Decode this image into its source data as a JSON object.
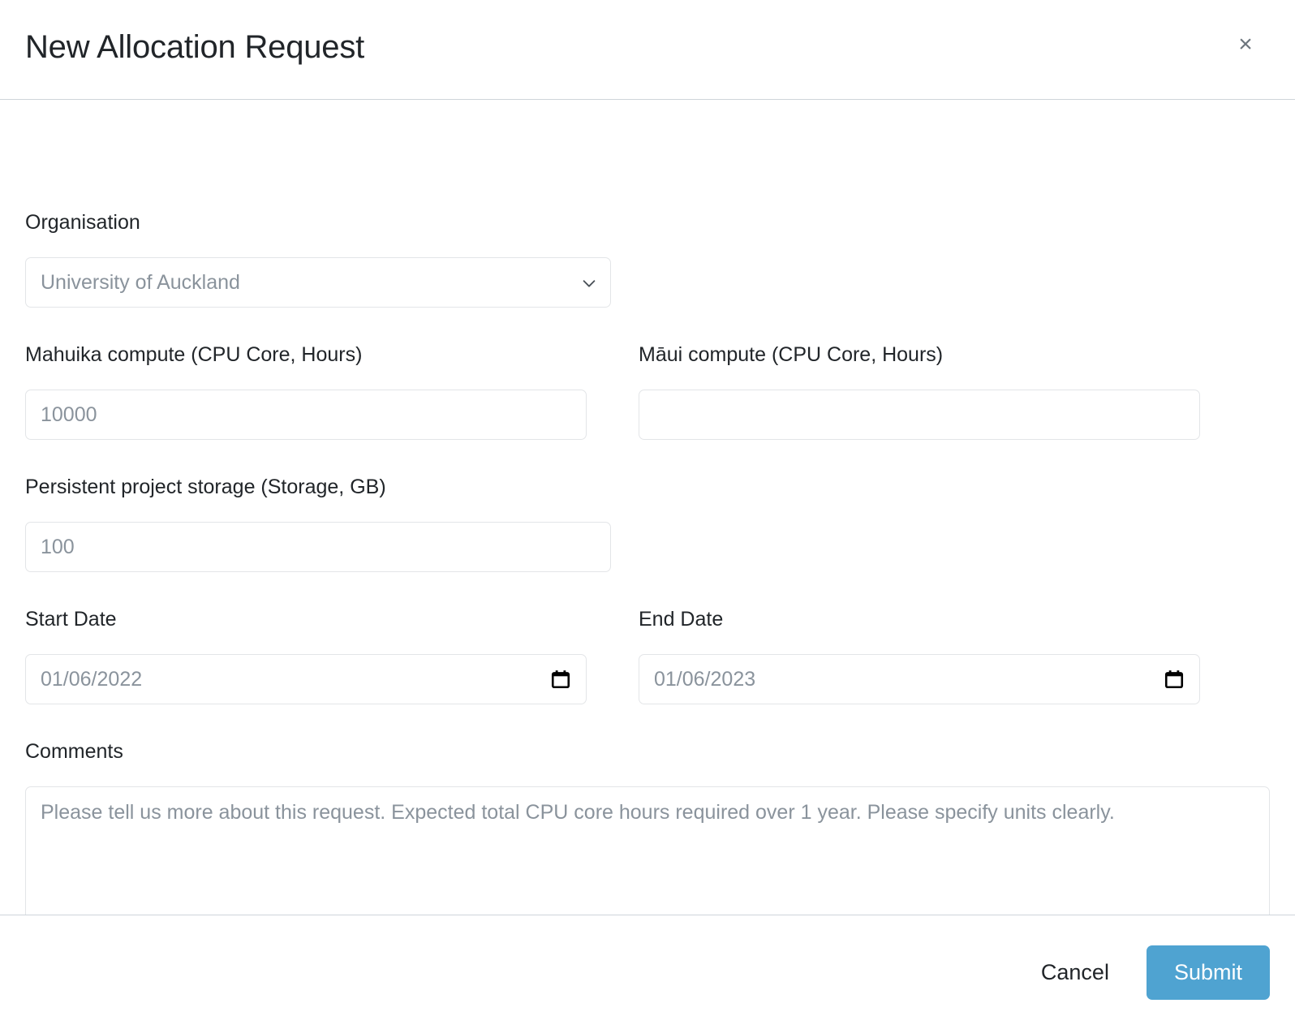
{
  "modal": {
    "title": "New Allocation Request",
    "close_icon": "close-icon",
    "close_label": "×"
  },
  "form": {
    "organisation": {
      "label": "Organisation",
      "value": "University of Auckland",
      "options": [
        "University of Auckland"
      ],
      "chevron_icon": "chevron-down-icon"
    },
    "mahuika": {
      "label": "Mahuika compute (CPU Core, Hours)",
      "value": "",
      "placeholder": "10000"
    },
    "maui": {
      "label": "Māui compute (CPU Core, Hours)",
      "value": "",
      "placeholder": ""
    },
    "storage": {
      "label": "Persistent project storage (Storage, GB)",
      "value": "",
      "placeholder": "100"
    },
    "start_date": {
      "label": "Start Date",
      "value": "01/06/2022",
      "calendar_icon": "calendar-icon"
    },
    "end_date": {
      "label": "End Date",
      "value": "01/06/2023",
      "calendar_icon": "calendar-icon"
    },
    "comments": {
      "label": "Comments",
      "value": "",
      "placeholder": "Please tell us more about this request. Expected total CPU core hours required over 1 year. Please specify units clearly."
    }
  },
  "footer": {
    "cancel_label": "Cancel",
    "submit_label": "Submit"
  },
  "colors": {
    "submit_background": "#4fa3d1",
    "submit_text": "#ffffff",
    "divider": "#ced4da",
    "field_border": "#e3e5e8",
    "placeholder_text": "#8a939c",
    "body_text": "#212529"
  }
}
